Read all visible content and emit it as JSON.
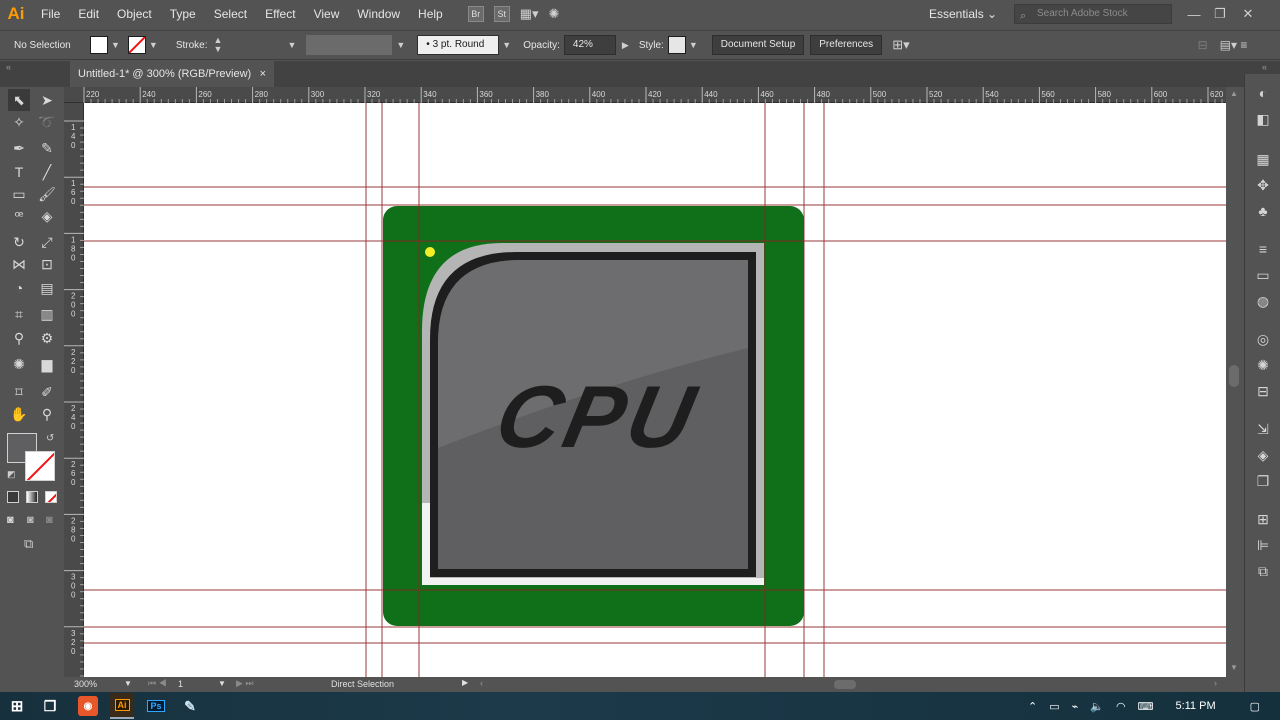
{
  "app": {
    "logo": "Ai"
  },
  "menu": {
    "items": [
      "File",
      "Edit",
      "Object",
      "Type",
      "Select",
      "Effect",
      "View",
      "Window",
      "Help"
    ],
    "icons": {
      "bridge": "Br",
      "stock": "St"
    }
  },
  "workspace": {
    "label": "Essentials"
  },
  "search": {
    "placeholder": "Search Adobe Stock"
  },
  "control": {
    "selection": "No Selection",
    "stroke_label": "Stroke:",
    "brush": "3 pt. Round",
    "opacity_label": "Opacity:",
    "opacity_value": "42%",
    "style_label": "Style:",
    "document_setup": "Document Setup",
    "preferences": "Preferences"
  },
  "document": {
    "tab_title": "Untitled-1* @ 300% (RGB/Preview)",
    "close": "×"
  },
  "ruler": {
    "top_ticks": [
      "220",
      "240",
      "260",
      "280",
      "300",
      "320",
      "340",
      "360",
      "380",
      "400",
      "420",
      "440",
      "460",
      "480",
      "500",
      "520",
      "540",
      "560",
      "580",
      "600",
      "620"
    ],
    "left_ticks": [
      "140",
      "160",
      "180",
      "200",
      "220",
      "240",
      "260",
      "280",
      "300",
      "320"
    ]
  },
  "artwork": {
    "label": "CPU",
    "board_color": "#0f7019",
    "chip_color": "#5f5e60",
    "rim_color": "#b5b5b5",
    "border_color": "#1e1e1e",
    "guide_color": "#8f2323",
    "anchor_color": "#f2ee28"
  },
  "status": {
    "zoom": "300%",
    "artboard_number": "1",
    "tool": "Direct Selection"
  },
  "taskbar": {
    "ai": "Ai",
    "ps": "Ps",
    "time": "5:11 PM"
  }
}
